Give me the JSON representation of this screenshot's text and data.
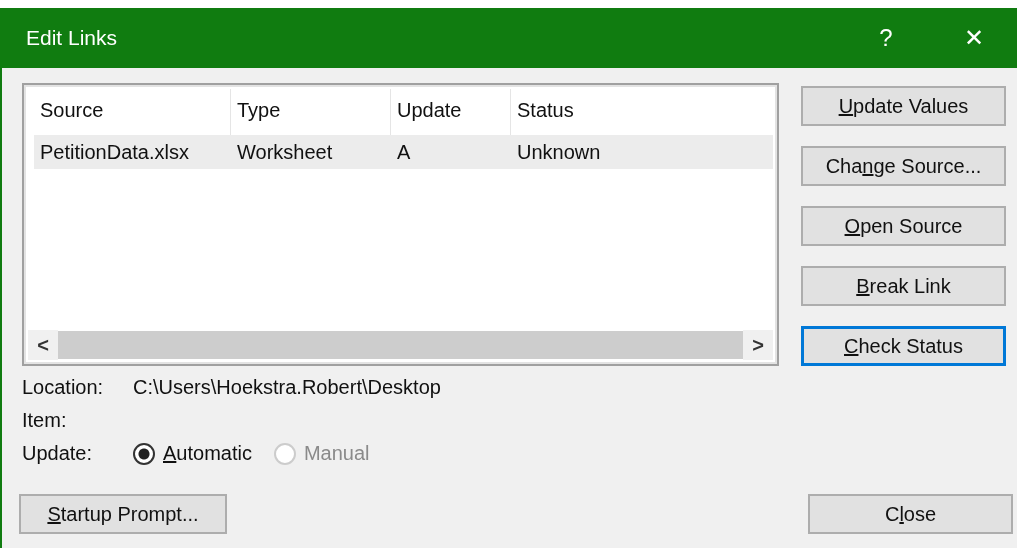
{
  "window": {
    "title": "Edit Links",
    "help": "?",
    "close": "✕"
  },
  "table": {
    "columns": [
      "Source",
      "Type",
      "Update",
      "Status"
    ],
    "rows": [
      {
        "cells": [
          "PetitionData.xlsx",
          "Worksheet",
          "A",
          "Unknown"
        ],
        "selected": true
      }
    ],
    "scroll_left": "<",
    "scroll_right": ">"
  },
  "side_buttons": [
    {
      "key": "U",
      "after": "pdate Values",
      "focused": false
    },
    {
      "before": "Cha",
      "key": "n",
      "after": "ge Source...",
      "focused": false
    },
    {
      "key": "O",
      "after": "pen Source",
      "focused": false
    },
    {
      "key": "B",
      "after": "reak Link",
      "focused": false
    },
    {
      "key": "C",
      "after": "heck Status",
      "focused": true
    }
  ],
  "location": {
    "label": "Location:",
    "value": "C:\\Users\\Hoekstra.Robert\\Desktop"
  },
  "item": {
    "label": "Item:"
  },
  "update": {
    "label": "Update:",
    "options": [
      {
        "key": "A",
        "after": "utomatic",
        "selected": true,
        "disabled": false
      },
      {
        "after": "Manual",
        "selected": false,
        "disabled": true
      }
    ]
  },
  "bottom_buttons": [
    {
      "key": "S",
      "after": "tartup Prompt...",
      "focused": false
    },
    {
      "before": "C",
      "key": "l",
      "after": "ose",
      "focused": false
    }
  ]
}
